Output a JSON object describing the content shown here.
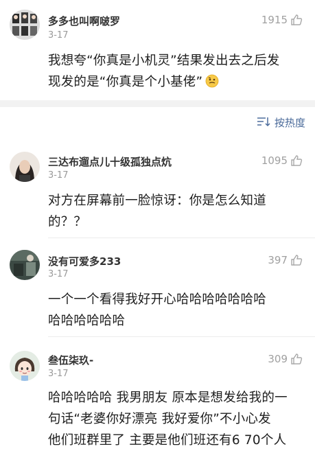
{
  "comments": [
    {
      "username": "多多也叫啊啵罗",
      "date": "3-17",
      "likes": "1915",
      "lines": [
        "我想夸“你真是小机灵”结果发出去之后发",
        "现发的是“你真是个小基佬”"
      ]
    },
    {
      "username": "三达布遛点儿十级孤独点炕",
      "date": "3-17",
      "likes": "1095",
      "lines": [
        "对方在屏幕前一脸惊讶：你是怎么知道",
        "的？？"
      ]
    },
    {
      "username": "没有可爱多233",
      "date": "3-17",
      "likes": "397",
      "lines": [
        "一个一个看得我好开心哈哈哈哈哈哈哈",
        "哈哈哈哈哈哈"
      ]
    },
    {
      "username": "叁伍柒玖-",
      "date": "3-17",
      "likes": "309",
      "lines": [
        "哈哈哈哈哈 我男朋友 原本是想发给我的一",
        "句话“老婆你好漂亮 我好爱你”不小心发",
        "他们班群里了 主要是他们班还有6 70个人"
      ]
    }
  ],
  "sort": {
    "label": "按热度"
  },
  "icons": {
    "like": "thumbs-up-icon",
    "sort": "sort-icon",
    "emoji": "thinking-face-emoji"
  },
  "colors": {
    "accent": "#4a6a9a",
    "muted": "#9a9a9a"
  }
}
